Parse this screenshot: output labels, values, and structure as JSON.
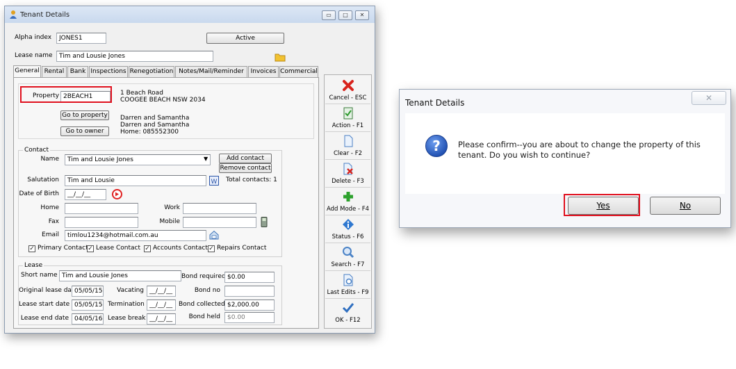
{
  "window": {
    "title": "Tenant Details",
    "min_glyph": "▭",
    "max_glyph": "□",
    "close_glyph": "✕",
    "icon": "user-icon"
  },
  "header": {
    "alpha_label": "Alpha index",
    "alpha_value": "JONES1",
    "status_button": "Active",
    "lease_name_label": "Lease name",
    "lease_name_value": "Tim and Lousie Jones"
  },
  "tabs": [
    "General",
    "Rental",
    "Bank",
    "Inspections",
    "Renegotiation",
    "Notes/Mail/Reminder",
    "Invoices",
    "Commercial"
  ],
  "property": {
    "label": "Property",
    "value": "2BEACH1",
    "address_line1": "1 Beach Road",
    "address_line2": "COOGEE BEACH  NSW  2034",
    "go_property": "Go to property",
    "go_owner": "Go to owner",
    "owner_line1": "Darren and Samantha",
    "owner_line2": "Darren and Samantha",
    "owner_line3": "Home: 085552300"
  },
  "contact": {
    "group_title": "Contact",
    "name_label": "Name",
    "name_value": "Tim and Lousie Jones",
    "add_contact": "Add contact",
    "remove_contact": "Remove contact",
    "salutation_label": "Salutation",
    "salutation_value": "Tim and Lousie",
    "total_contacts": "Total contacts: 1",
    "dob_label": "Date of Birth",
    "dob_value": "__/__/__",
    "home_label": "Home",
    "work_label": "Work",
    "fax_label": "Fax",
    "mobile_label": "Mobile",
    "email_label": "Email",
    "email_value": "timlou1234@hotmail.com.au",
    "checks": [
      "Primary Contact",
      "Lease Contact",
      "Accounts Contact",
      "Repairs Contact"
    ],
    "check_mark": "✓"
  },
  "lease": {
    "group_title": "Lease",
    "short_name_label": "Short name",
    "short_name_value": "Tim and Lousie Jones",
    "bond_required_label": "Bond required",
    "bond_required_value": "$0.00",
    "original_label": "Original lease date",
    "original_value": "05/05/15",
    "vacating_label": "Vacating",
    "vacating_value": "__/__/__",
    "bond_no_label": "Bond no",
    "start_label": "Lease start date",
    "start_value": "05/05/15",
    "termination_label": "Termination",
    "termination_value": "__/__/__",
    "bond_collected_label": "Bond collected",
    "bond_collected_value": "$2,000.00",
    "end_label": "Lease end date",
    "end_value": "04/05/16",
    "break_label": "Lease break",
    "break_value": "__/__/__",
    "bond_held_label": "Bond held",
    "bond_held_value": "$0.00"
  },
  "toolbar": [
    {
      "label": "Cancel - ESC",
      "icon": "cancel-x-icon",
      "color": "#d8231c"
    },
    {
      "label": "Action - F1",
      "icon": "action-document-icon",
      "color": "#3a9a3a"
    },
    {
      "label": "Clear - F2",
      "icon": "clear-page-icon",
      "color": "#5a8fd0"
    },
    {
      "label": "Delete - F3",
      "icon": "delete-page-icon",
      "color": "#d8231c"
    },
    {
      "label": "Add Mode - F4",
      "icon": "plus-icon",
      "color": "#2da12d"
    },
    {
      "label": "Status - F6",
      "icon": "info-icon",
      "color": "#2f78d0"
    },
    {
      "label": "Search - F7",
      "icon": "magnifier-icon",
      "color": "#4a82c6"
    },
    {
      "label": "Last Edits - F9",
      "icon": "last-edits-icon",
      "color": "#4a82c6"
    },
    {
      "label": "OK - F12",
      "icon": "checkmark-icon",
      "color": "#2f6fc0"
    }
  ],
  "dialog": {
    "title": "Tenant Details",
    "close_glyph": "✕",
    "message": "Please confirm--you are about to change the property of this tenant. Do you wish to continue?",
    "yes": "Yes",
    "no": "No",
    "icon": "question-icon"
  },
  "colors": {
    "highlight": "#e0101e",
    "question_blue": "#2b63c7"
  }
}
